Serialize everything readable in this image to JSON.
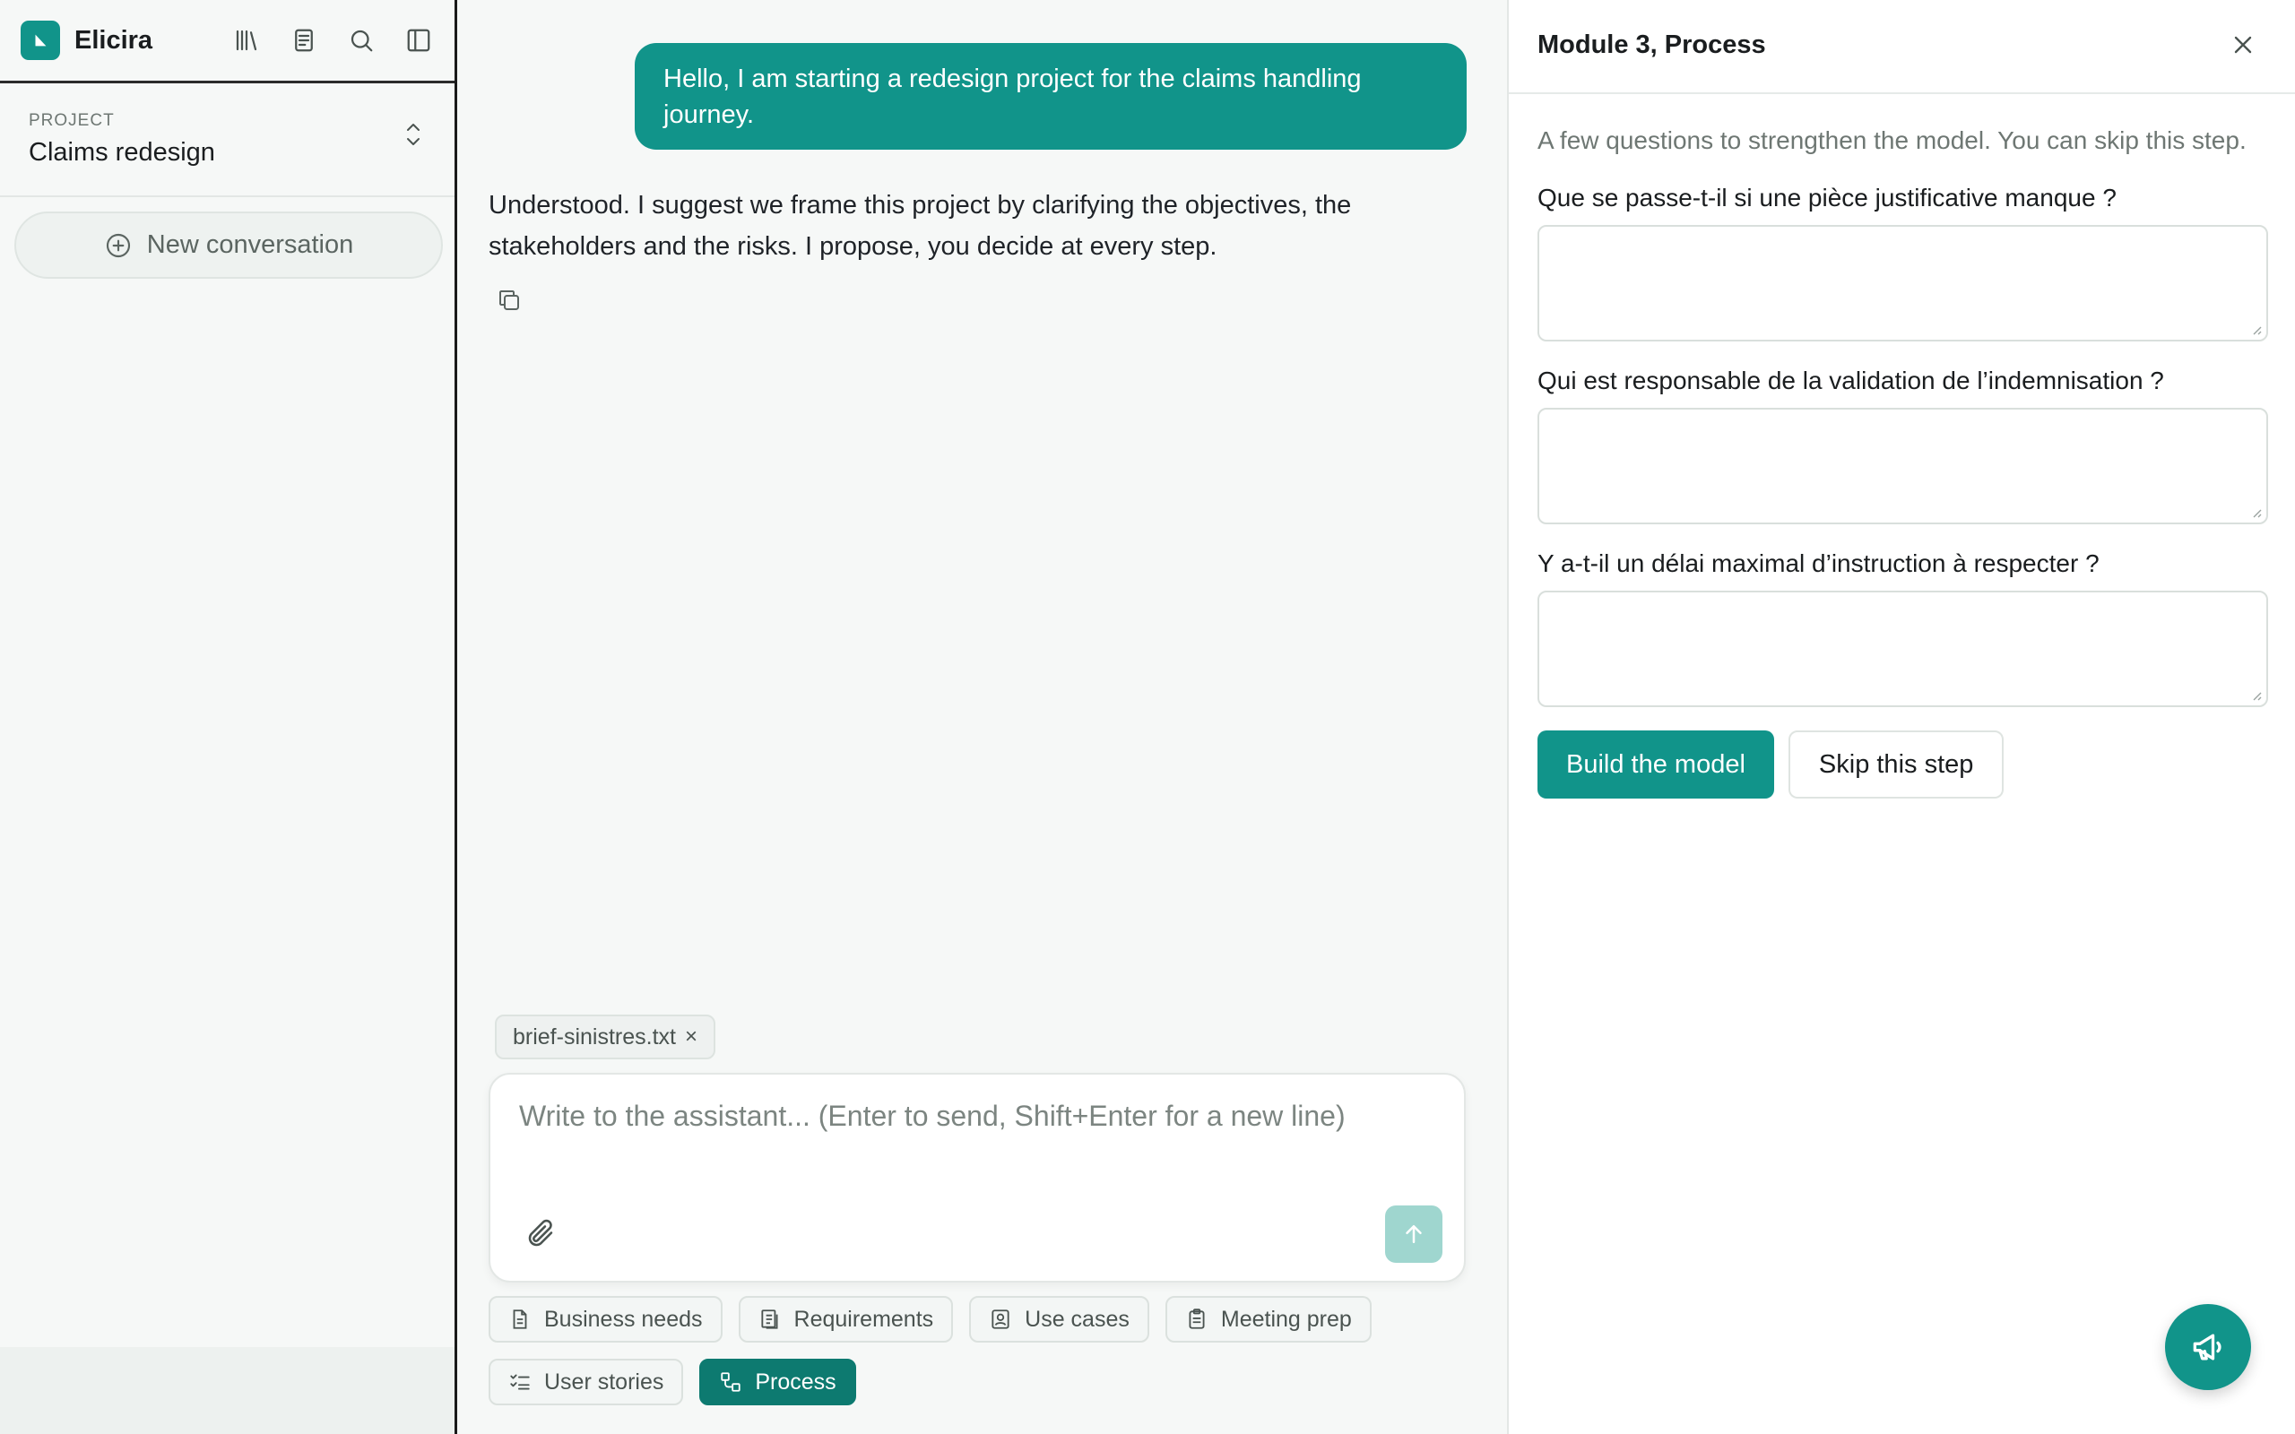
{
  "app": {
    "name": "Elicira"
  },
  "sidebar": {
    "project_label": "PROJECT",
    "project_name": "Claims redesign",
    "new_conversation": "New conversation",
    "tool_icons": [
      "library-icon",
      "document-icon",
      "search-icon",
      "sidebar-toggle-icon"
    ]
  },
  "chat": {
    "user_message": "Hello, I am starting a redesign project for the claims handling journey.",
    "assistant_message": "Understood. I suggest we frame this project by clarifying the objectives, the stakeholders and the risks. I propose, you decide at every step.",
    "attachment": "brief-sinistres.txt",
    "attachment_remove": "×",
    "composer_placeholder": "Write to the assistant...  (Enter to send, Shift+Enter for a new line)"
  },
  "modules": [
    {
      "label": "Business needs",
      "icon": "document-icon",
      "active": false
    },
    {
      "label": "Requirements",
      "icon": "list-document-icon",
      "active": false
    },
    {
      "label": "Use cases",
      "icon": "user-card-icon",
      "active": false
    },
    {
      "label": "Meeting prep",
      "icon": "clipboard-icon",
      "active": false
    },
    {
      "label": "User stories",
      "icon": "checklist-icon",
      "active": false
    },
    {
      "label": "Process",
      "icon": "flow-icon",
      "active": true
    }
  ],
  "panel": {
    "title": "Module 3, Process",
    "intro": "A few questions to strengthen the model. You can skip this step.",
    "questions": [
      {
        "label": "Que se passe-t-il si une pièce justificative manque ?",
        "value": ""
      },
      {
        "label": "Qui est responsable de la validation de l’indemnisation ?",
        "value": ""
      },
      {
        "label": "Y a-t-il un délai maximal d’instruction à respecter ?",
        "value": ""
      }
    ],
    "build_button": "Build the model",
    "skip_button": "Skip this step"
  },
  "colors": {
    "accent": "#11948a",
    "accent_dark": "#0d7a70",
    "send_disabled": "#9fd6cf"
  }
}
